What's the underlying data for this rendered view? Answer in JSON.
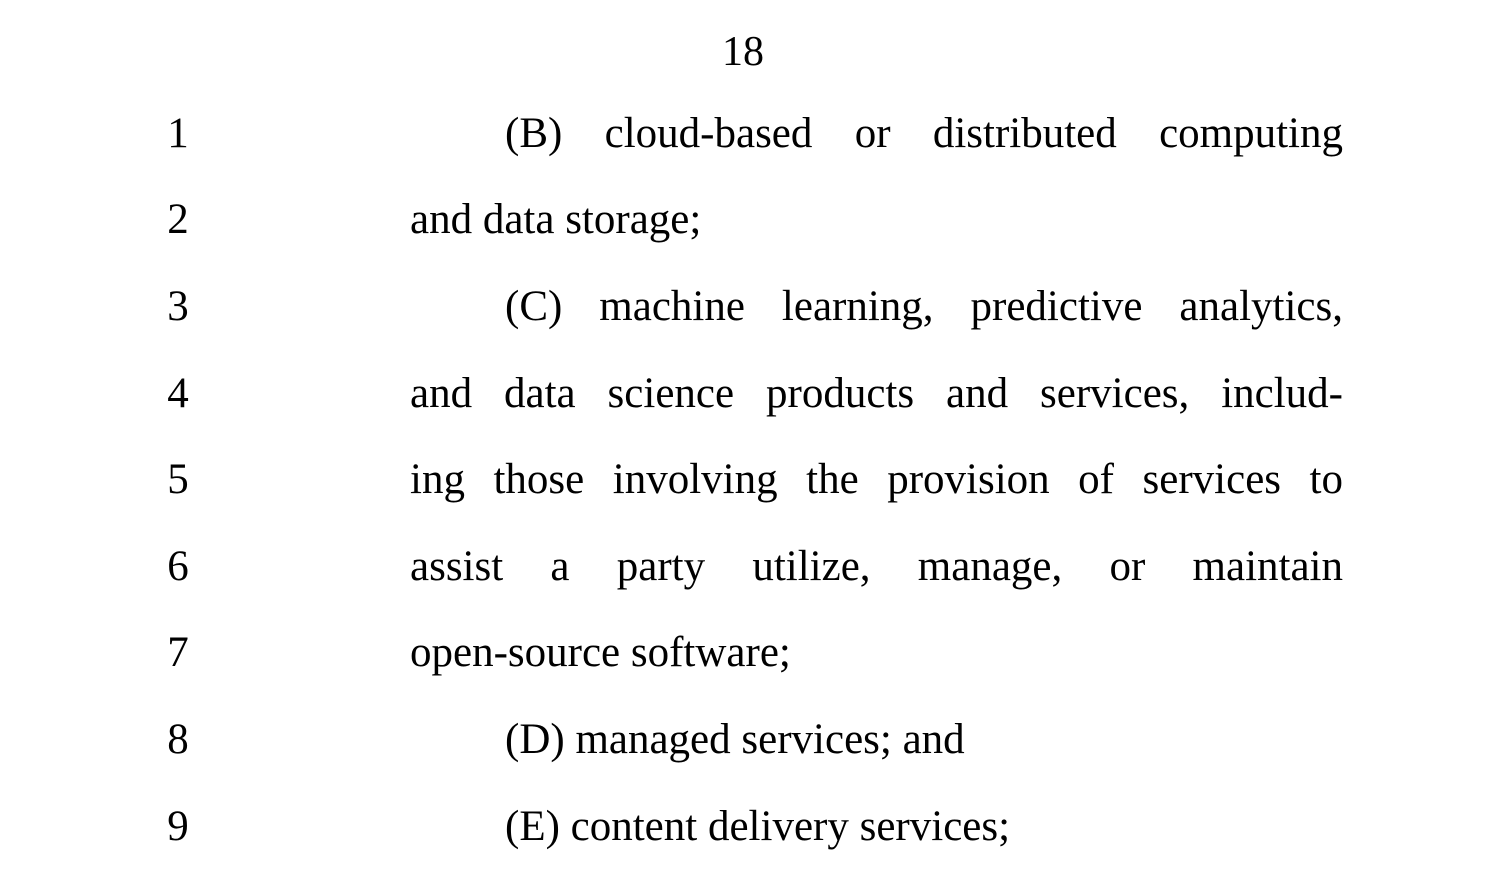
{
  "page_number": "18",
  "lines": [
    {
      "number": "1",
      "text": "(B) cloud-based or distributed computing",
      "indent": true,
      "justify": true
    },
    {
      "number": "2",
      "text": "and data storage;",
      "indent": false,
      "justify": false
    },
    {
      "number": "3",
      "text": "(C) machine learning, predictive analytics,",
      "indent": true,
      "justify": true
    },
    {
      "number": "4",
      "text": "and data science products and services, includ-",
      "indent": false,
      "justify": true
    },
    {
      "number": "5",
      "text": "ing those involving the provision of services to",
      "indent": false,
      "justify": true
    },
    {
      "number": "6",
      "text": "assist a party utilize, manage, or maintain",
      "indent": false,
      "justify": true
    },
    {
      "number": "7",
      "text": "open-source software;",
      "indent": false,
      "justify": false
    },
    {
      "number": "8",
      "text": "(D) managed services; and",
      "indent": true,
      "justify": false
    },
    {
      "number": "9",
      "text": "(E) content delivery services;",
      "indent": true,
      "justify": false
    }
  ]
}
